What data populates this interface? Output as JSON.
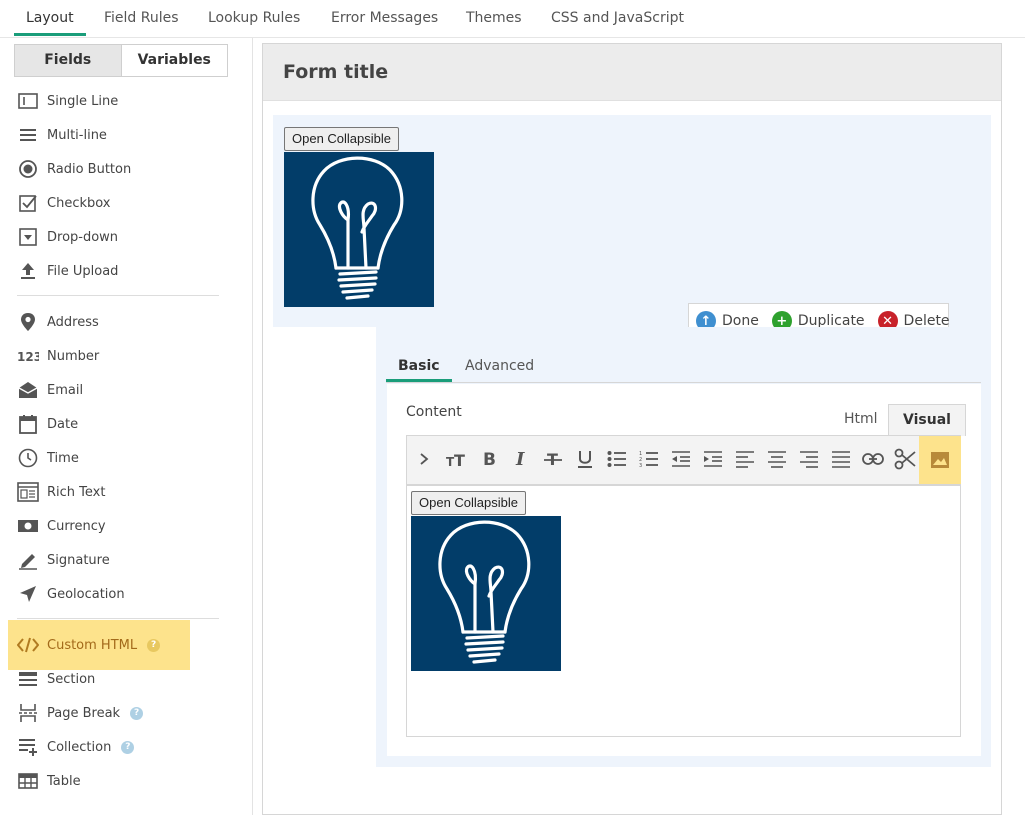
{
  "top_tabs": [
    "Layout",
    "Field Rules",
    "Lookup Rules",
    "Error Messages",
    "Themes",
    "CSS and JavaScript"
  ],
  "segment": {
    "fields": "Fields",
    "variables": "Variables"
  },
  "fields": [
    {
      "label": "Single Line",
      "icon": "single-line-icon"
    },
    {
      "label": "Multi-line",
      "icon": "multi-line-icon"
    },
    {
      "label": "Radio Button",
      "icon": "radio-icon"
    },
    {
      "label": "Checkbox",
      "icon": "checkbox-icon"
    },
    {
      "label": "Drop-down",
      "icon": "dropdown-icon"
    },
    {
      "label": "File Upload",
      "icon": "upload-icon"
    },
    {
      "label": "Address",
      "icon": "map-pin-icon"
    },
    {
      "label": "Number",
      "icon": "number-icon"
    },
    {
      "label": "Email",
      "icon": "envelope-icon"
    },
    {
      "label": "Date",
      "icon": "calendar-icon"
    },
    {
      "label": "Time",
      "icon": "clock-icon"
    },
    {
      "label": "Rich Text",
      "icon": "rich-text-icon"
    },
    {
      "label": "Currency",
      "icon": "currency-icon"
    },
    {
      "label": "Signature",
      "icon": "pen-icon"
    },
    {
      "label": "Geolocation",
      "icon": "location-arrow-icon"
    },
    {
      "label": "Custom HTML",
      "icon": "code-icon"
    },
    {
      "label": "Section",
      "icon": "section-icon"
    },
    {
      "label": "Page Break",
      "icon": "page-break-icon"
    },
    {
      "label": "Collection",
      "icon": "collection-icon"
    },
    {
      "label": "Table",
      "icon": "table-icon"
    }
  ],
  "help_glyph": "?",
  "form": {
    "title": "Form title"
  },
  "collapsible_button": "Open Collapsible",
  "actions": {
    "done": "Done",
    "duplicate": "Duplicate",
    "delete": "Delete"
  },
  "sub_tabs": {
    "basic": "Basic",
    "advanced": "Advanced"
  },
  "content": {
    "label": "Content",
    "html_tab": "Html",
    "visual_tab": "Visual"
  },
  "toolbar_buttons": [
    "more-icon",
    "font-size-icon",
    "bold-icon",
    "italic-icon",
    "strikethrough-icon",
    "underline-icon",
    "bullet-list-icon",
    "numbered-list-icon",
    "outdent-icon",
    "indent-icon",
    "align-left-icon",
    "align-center-icon",
    "align-right-icon",
    "justify-icon",
    "link-icon",
    "cut-icon",
    "image-icon"
  ],
  "colors": {
    "accent": "#1a9d7a",
    "highlight": "#fde38c",
    "done": "#3f8fd0",
    "duplicate": "#2ea12e",
    "delete": "#c8222a",
    "image_bg": "#023d69"
  }
}
